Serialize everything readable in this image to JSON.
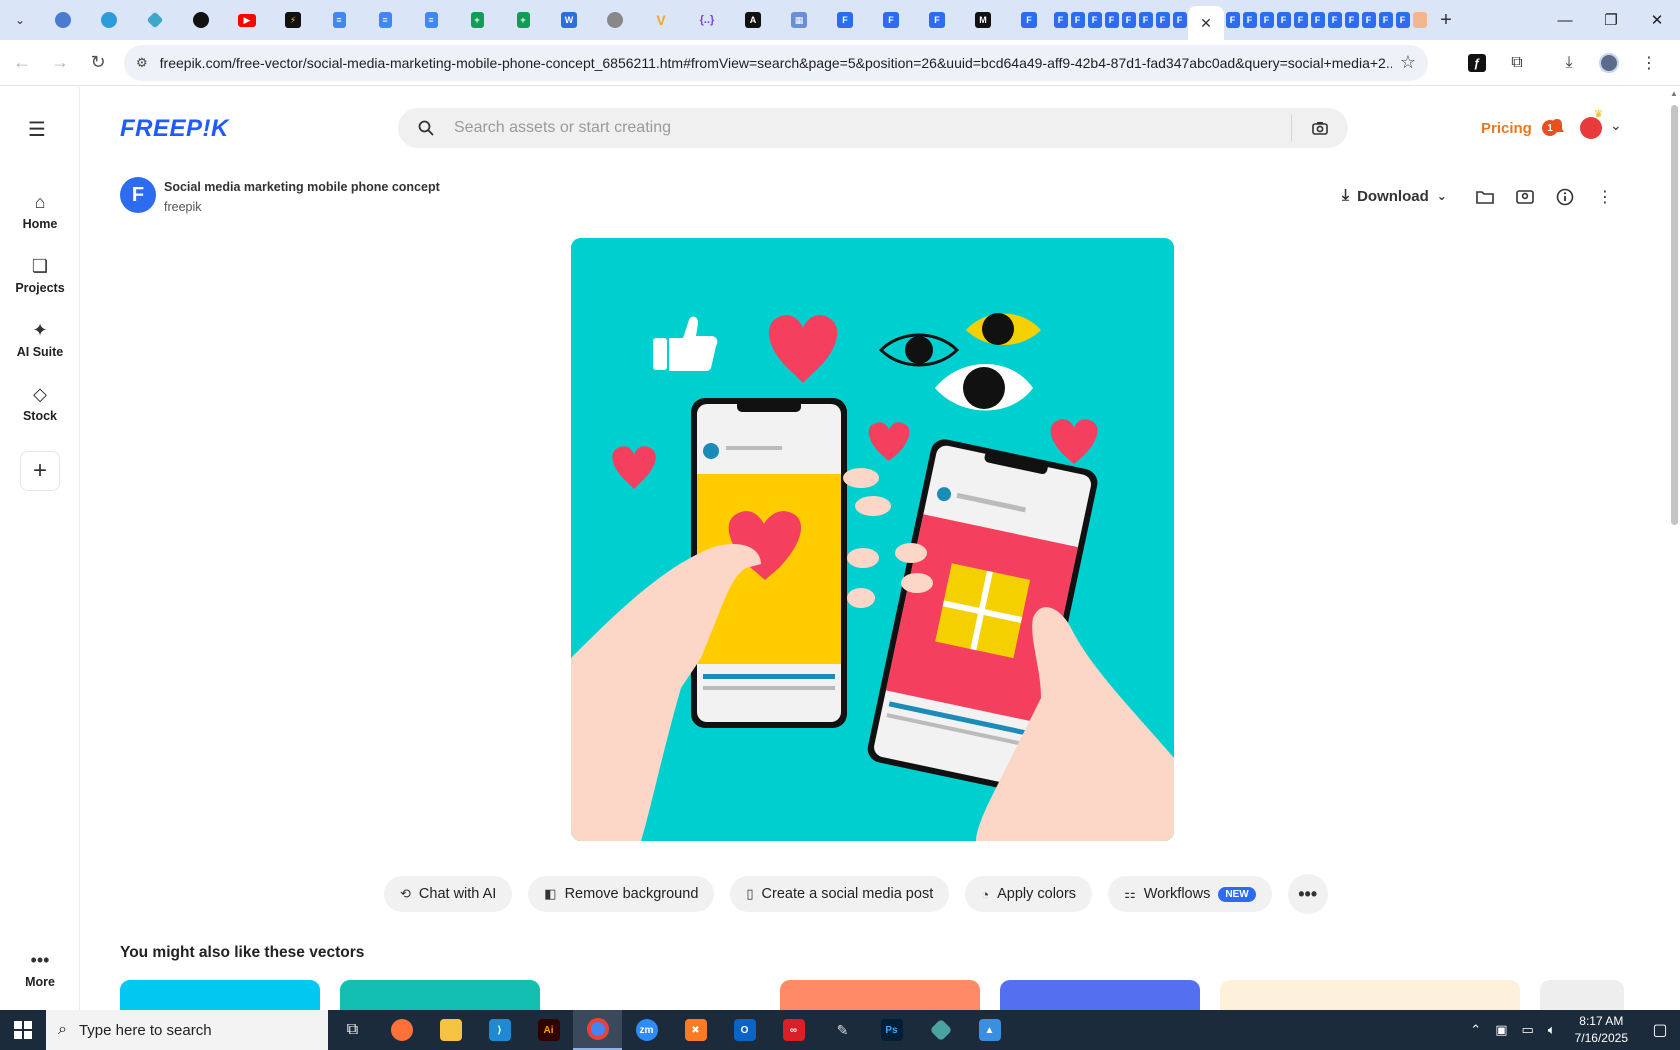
{
  "browser": {
    "url": "freepik.com/free-vector/social-media-marketing-mobile-phone-concept_6856211.htm#fromView=search&page=5&position=26&uuid=bcd64a49-aff9-42b4-87d1-fad347abc0ad&query=social+media+2...",
    "tab_close_glyph": "✕",
    "new_tab_glyph": "+"
  },
  "freepik": {
    "logo": "FREEP!K",
    "search_placeholder": "Search assets or start creating",
    "pricing": "Pricing",
    "notification_count": "1"
  },
  "sidebar": {
    "items": [
      {
        "label": "Home"
      },
      {
        "label": "Projects"
      },
      {
        "label": "AI Suite"
      },
      {
        "label": "Stock"
      }
    ],
    "more_label": "More"
  },
  "asset": {
    "title": "Social media marketing mobile phone concept",
    "author": "freepik",
    "download_label": "Download"
  },
  "ai_tools": [
    {
      "label": "Chat with AI"
    },
    {
      "label": "Remove background"
    },
    {
      "label": "Create a social media post"
    },
    {
      "label": "Apply colors"
    },
    {
      "label": "Workflows",
      "badge": "NEW"
    }
  ],
  "related": {
    "title": "You might also like these vectors"
  },
  "taskbar": {
    "search_placeholder": "Type here to search",
    "time": "8:17 AM",
    "date": "7/16/2025"
  },
  "colors": {
    "brand": "#1f5bff",
    "pricing": "#e8781f",
    "preview_bg": "#00cfcf",
    "new_badge": "#2d6bf0"
  }
}
